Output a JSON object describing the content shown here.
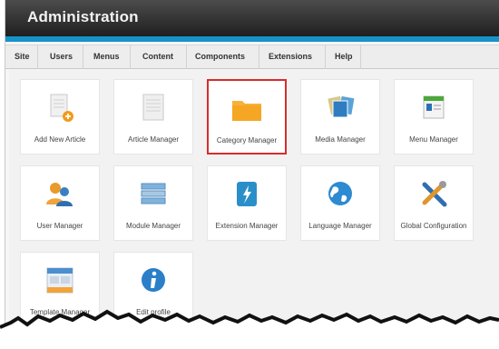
{
  "header": {
    "title": "Administration"
  },
  "menu": [
    {
      "label": "Site"
    },
    {
      "label": "Users"
    },
    {
      "label": "Menus"
    },
    {
      "label": "Content"
    },
    {
      "label": "Components"
    },
    {
      "label": "Extensions"
    },
    {
      "label": "Help"
    }
  ],
  "tiles": [
    {
      "label": "Add New Article",
      "icon": "add-article-icon"
    },
    {
      "label": "Article Manager",
      "icon": "article-manager-icon"
    },
    {
      "label": "Category Manager",
      "icon": "folder-icon",
      "selected": true
    },
    {
      "label": "Media Manager",
      "icon": "media-icon"
    },
    {
      "label": "Menu Manager",
      "icon": "menu-manager-icon"
    },
    {
      "label": "User Manager",
      "icon": "users-icon"
    },
    {
      "label": "Module Manager",
      "icon": "module-icon"
    },
    {
      "label": "Extension Manager",
      "icon": "extension-icon"
    },
    {
      "label": "Language Manager",
      "icon": "globe-icon"
    },
    {
      "label": "Global Configuration",
      "icon": "tools-icon"
    },
    {
      "label": "Template Manager",
      "icon": "template-icon"
    },
    {
      "label": "Edit profile",
      "icon": "info-icon"
    }
  ],
  "colors": {
    "header_bg": "#2b2b2b",
    "accent_blue": "#1792c9",
    "selection_red": "#d72c2c",
    "folder_orange": "#f5a623"
  }
}
